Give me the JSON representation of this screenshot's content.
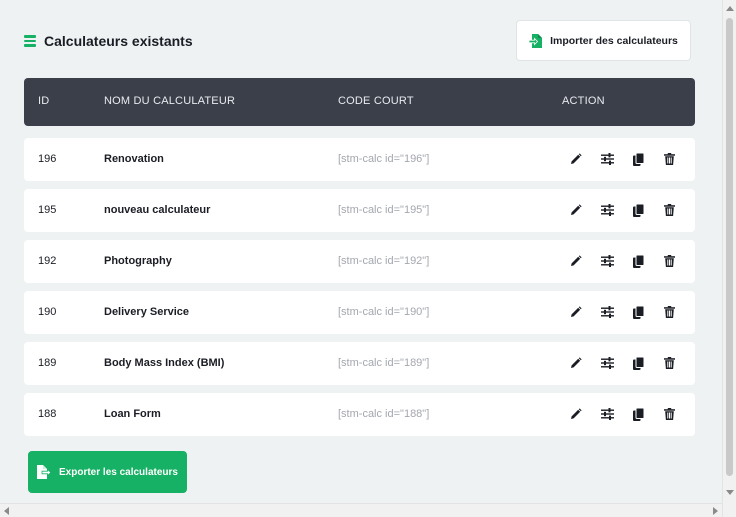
{
  "header": {
    "title": "Calculateurs existants",
    "import_label": "Importer des calculateurs"
  },
  "table": {
    "columns": [
      "ID",
      "NOM DU CALCULATEUR",
      "CODE COURT",
      "ACTION"
    ],
    "rows": [
      {
        "id": "196",
        "name": "Renovation",
        "code": "[stm-calc id=\"196\"]"
      },
      {
        "id": "195",
        "name": "nouveau calculateur",
        "code": "[stm-calc id=\"195\"]"
      },
      {
        "id": "192",
        "name": "Photography",
        "code": "[stm-calc id=\"192\"]"
      },
      {
        "id": "190",
        "name": "Delivery Service",
        "code": "[stm-calc id=\"190\"]"
      },
      {
        "id": "189",
        "name": "Body Mass Index (BMI)",
        "code": "[stm-calc id=\"189\"]"
      },
      {
        "id": "188",
        "name": "Loan Form",
        "code": "[stm-calc id=\"188\"]"
      }
    ],
    "action_icons": [
      "pencil-icon",
      "sliders-icon",
      "copy-icon",
      "trash-icon"
    ]
  },
  "footer": {
    "export_label": "Exporter les calculateurs"
  },
  "colors": {
    "accent": "#16b164",
    "header_bg": "#3b3f4a",
    "page_bg": "#eef2f3"
  }
}
